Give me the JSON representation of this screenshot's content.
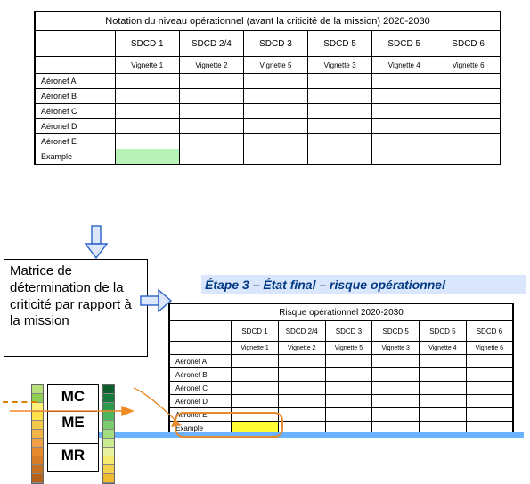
{
  "top": {
    "title": "Notation du niveau opérationnel (avant la criticité de la mission) 2020-2030",
    "cols": [
      "SDCD 1",
      "SDCD 2/4",
      "SDCD 3",
      "SDCD 5",
      "SDCD 5",
      "SDCD 6"
    ],
    "sub": [
      "Vignette 1",
      "Vignette 2",
      "Vignette 5",
      "Vignette 3",
      "Vignette 4",
      "Vignette 6"
    ],
    "rows": [
      "Aéronef A",
      "Aéronef B",
      "Aéronef C",
      "Aéronef D",
      "Aéronef E",
      "Example"
    ],
    "highlight": {
      "row": 5,
      "col": 0,
      "class": "hl-green"
    }
  },
  "bottom": {
    "title": "Risque opérationnel 2020-2030",
    "cols": [
      "SDCD 1",
      "SDCD 2/4",
      "SDCD 3",
      "SDCD 5",
      "SDCD 5",
      "SDCD 6"
    ],
    "sub": [
      "Vignette 1",
      "Vignette 2",
      "Vignette 5",
      "Vignette 3",
      "Vignette 4",
      "Vignette 6"
    ],
    "rows": [
      "Aéronef A",
      "Aéronef B",
      "Aéronef C",
      "Aéronef D",
      "Aéronef E",
      "Example"
    ],
    "highlight": {
      "row": 5,
      "col": 0,
      "class": "hl-yellow"
    }
  },
  "matrix_label": "Matrice de détermination de la criticité par rapport à la mission",
  "step3": "Étape 3 – État final – risque opérationnel",
  "legend": {
    "labels": [
      "MC",
      "ME",
      "MR"
    ],
    "palette_left": [
      "#b7e07a",
      "#8fce55",
      "#fff17a",
      "#ffe24a",
      "#f6c94d",
      "#f4b44a",
      "#f1a04a",
      "#e68a2e",
      "#d47c28",
      "#c46f22",
      "#b5621c"
    ],
    "palette_right": [
      "#0d5e2d",
      "#157a3a",
      "#2e9a4b",
      "#4cb65b",
      "#7acb6c",
      "#a3dd7e",
      "#c9ec8f",
      "#e7f39f",
      "#f5e96e",
      "#f2d24b",
      "#eeba30"
    ]
  }
}
